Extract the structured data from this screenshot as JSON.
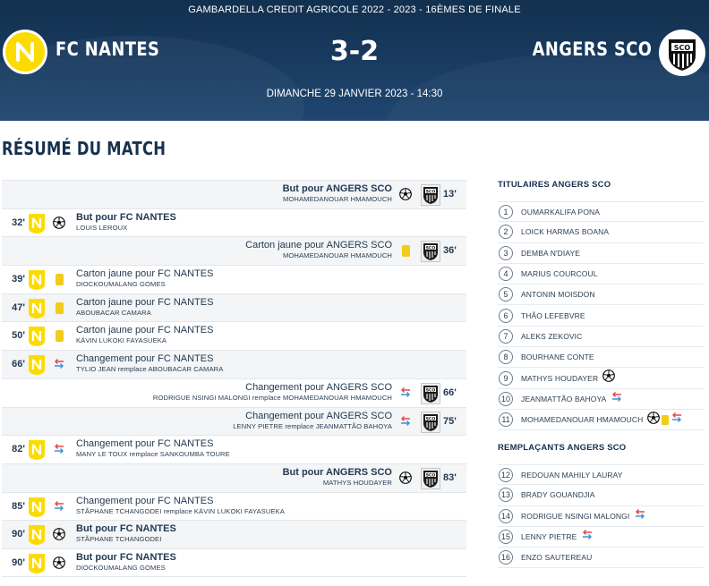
{
  "match": {
    "competition": "GAMBARDELLA CREDIT AGRICOLE 2022 - 2023 - 16ÈMES DE FINALE",
    "home_team": "FC NANTES",
    "away_team": "ANGERS SCO",
    "score": "3-2",
    "datetime": "DIMANCHE 29 JANVIER 2023 - 14:30"
  },
  "section_title": "RÉSUMÉ DU MATCH",
  "events": [
    {
      "side": "away",
      "type": "goal",
      "minute": "13'",
      "title": "But pour ANGERS SCO",
      "detail": "MOHAMEDANOUAR HMAMOUCH"
    },
    {
      "side": "home",
      "type": "goal",
      "minute": "32'",
      "title": "But pour FC NANTES",
      "detail": "LOUIS LEROUX"
    },
    {
      "side": "away",
      "type": "yellow",
      "minute": "36'",
      "title": "Carton jaune pour ANGERS SCO",
      "detail": "MOHAMEDANOUAR HMAMOUCH"
    },
    {
      "side": "home",
      "type": "yellow",
      "minute": "39'",
      "title": "Carton jaune pour FC NANTES",
      "detail": "DIOCKOUMALANG GOMES"
    },
    {
      "side": "home",
      "type": "yellow",
      "minute": "47'",
      "title": "Carton jaune pour FC NANTES",
      "detail": "ABOUBACAR CAMARA"
    },
    {
      "side": "home",
      "type": "yellow",
      "minute": "50'",
      "title": "Carton jaune pour FC NANTES",
      "detail": "KÄVIN LUKOKI FAYASUEKA"
    },
    {
      "side": "home",
      "type": "sub",
      "minute": "66'",
      "title": "Changement pour FC NANTES",
      "detail": "TYLIO JEAN remplace ABOUBACAR CAMARA"
    },
    {
      "side": "away",
      "type": "sub",
      "minute": "66'",
      "title": "Changement pour ANGERS SCO",
      "detail": "RODRIGUE NSINGI MALONGI remplace MOHAMEDANOUAR HMAMOUCH"
    },
    {
      "side": "away",
      "type": "sub",
      "minute": "75'",
      "title": "Changement pour ANGERS SCO",
      "detail": "LENNY PIETRE remplace JEANMATTÃO BAHOYA"
    },
    {
      "side": "home",
      "type": "sub",
      "minute": "82'",
      "title": "Changement pour FC NANTES",
      "detail": "MANY LE TOUX remplace SANKOUMBA TOURE"
    },
    {
      "side": "away",
      "type": "goal",
      "minute": "83'",
      "title": "But pour ANGERS SCO",
      "detail": "MATHYS HOUDAYER"
    },
    {
      "side": "home",
      "type": "sub",
      "minute": "85'",
      "title": "Changement pour FC NANTES",
      "detail": "STÃPHANE TCHANGODEI remplace KÄVIN LUKOKI FAYASUEKA"
    },
    {
      "side": "home",
      "type": "goal",
      "minute": "90'",
      "title": "But pour FC NANTES",
      "detail": "STÃPHANE TCHANGODEI"
    },
    {
      "side": "home",
      "type": "goal",
      "minute": "90'",
      "title": "But pour FC NANTES",
      "detail": "DIOCKOUMALANG GOMES"
    }
  ],
  "starters": {
    "heading": "TITULAIRES ANGERS SCO",
    "players": [
      {
        "num": "1",
        "name": "OUMARKALIFA PONA",
        "icons": []
      },
      {
        "num": "2",
        "name": "LOICK HARMAS BOANA",
        "icons": []
      },
      {
        "num": "3",
        "name": "DEMBA N'DIAYE",
        "icons": []
      },
      {
        "num": "4",
        "name": "MARIUS COURCOUL",
        "icons": []
      },
      {
        "num": "5",
        "name": "ANTONIN MOISDON",
        "icons": []
      },
      {
        "num": "6",
        "name": "THÃO LEFEBVRE",
        "icons": []
      },
      {
        "num": "7",
        "name": "ALEKS ZEKOVIC",
        "icons": []
      },
      {
        "num": "8",
        "name": "BOURHANE CONTE",
        "icons": []
      },
      {
        "num": "9",
        "name": "MATHYS HOUDAYER",
        "icons": [
          "goal"
        ]
      },
      {
        "num": "10",
        "name": "JEANMATTÃO BAHOYA",
        "icons": [
          "sub"
        ]
      },
      {
        "num": "11",
        "name": "MOHAMEDANOUAR HMAMOUCH",
        "icons": [
          "goal",
          "yellow",
          "sub"
        ]
      }
    ]
  },
  "substitutes": {
    "heading": "REMPLAÇANTS ANGERS SCO",
    "players": [
      {
        "num": "12",
        "name": "REDOUAN MAHILY LAURAY",
        "icons": []
      },
      {
        "num": "13",
        "name": "BRADY GOUANDJIA",
        "icons": []
      },
      {
        "num": "14",
        "name": "RODRIGUE NSINGI MALONGI",
        "icons": [
          "sub"
        ]
      },
      {
        "num": "15",
        "name": "LENNY PIETRE",
        "icons": [
          "sub"
        ]
      },
      {
        "num": "16",
        "name": "ENZO SAUTEREAU",
        "icons": []
      }
    ]
  },
  "colors": {
    "banner": "#1a3d63",
    "nantes_yellow": "#fcdc00",
    "yellow_card": "#f2cb1d",
    "sub_out": "#e8434a",
    "sub_in": "#3d8fd6"
  },
  "icons": {
    "goal": "football-icon",
    "yellow": "yellow-card-icon",
    "sub": "substitution-icon",
    "home_logo": "fc-nantes-logo",
    "away_logo": "angers-sco-logo"
  }
}
